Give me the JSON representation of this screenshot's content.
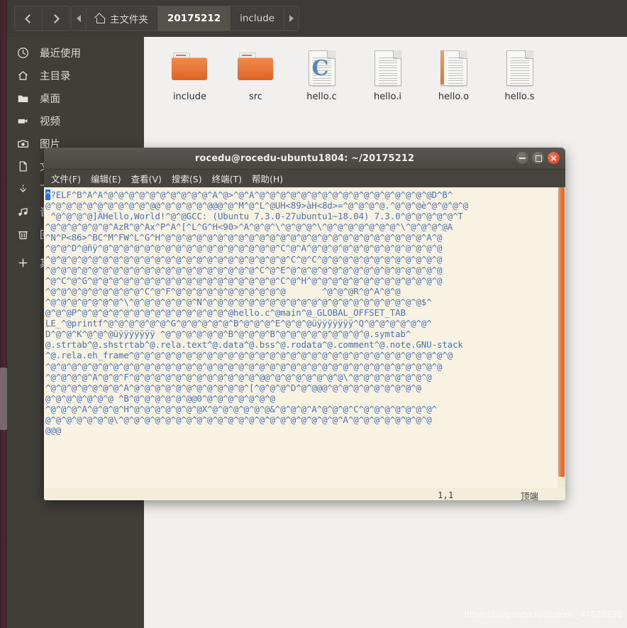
{
  "file_manager": {
    "nav": {
      "back_label": "‹",
      "forward_label": "›"
    },
    "breadcrumb": {
      "left_arrow": "◂",
      "right_arrow": "▸",
      "items": [
        {
          "label": "主文件夹",
          "icon": "home-icon",
          "active": false
        },
        {
          "label": "20175212",
          "icon": "",
          "active": true
        },
        {
          "label": "include",
          "icon": "",
          "active": false
        }
      ]
    },
    "sidebar": {
      "items": [
        {
          "label": "最近使用",
          "icon": "clock-icon"
        },
        {
          "label": "主目录",
          "icon": "home-icon"
        },
        {
          "label": "桌面",
          "icon": "folder-icon"
        },
        {
          "label": "视频",
          "icon": "video-icon"
        },
        {
          "label": "图片",
          "icon": "camera-icon"
        },
        {
          "label": "文档",
          "icon": "document-icon"
        },
        {
          "label": "下载",
          "icon": "download-icon"
        },
        {
          "label": "音乐",
          "icon": "music-icon"
        },
        {
          "label": "回收站",
          "icon": "trash-icon"
        },
        {
          "label": "其他位置",
          "icon": "plus-icon"
        }
      ]
    },
    "files": [
      {
        "name": "include",
        "type": "folder"
      },
      {
        "name": "src",
        "type": "folder"
      },
      {
        "name": "hello.c",
        "type": "c-source"
      },
      {
        "name": "hello.i",
        "type": "document"
      },
      {
        "name": "hello.o",
        "type": "object"
      },
      {
        "name": "hello.s",
        "type": "document"
      }
    ]
  },
  "terminal": {
    "title": "rocedu@rocedu-ubuntu1804: ~/20175212",
    "window_buttons": {
      "minimize": "minimize-button",
      "maximize": "maximize-button",
      "close": "close-button"
    },
    "menu": [
      "文件(F)",
      "编辑(E)",
      "查看(V)",
      "搜索(S)",
      "终端(T)",
      "帮助(H)"
    ],
    "status": {
      "position": "1,1",
      "location": "顶端"
    },
    "lines": [
      "^?ELF^B^A^A^@^@^@^@^@^@^@^@^@^@^A^@>^@^A^@^@^@^@^@^@^@^@^@^@^@^@^@^@^@^@^@D^B^",
      "@^@^@^@^@^@^@^@^@^@^@@^@^@^@^@^@@@^@^M^@^L^@UH<89>àH<8d>=^@^@^@^@.^@^@^@è^@^@^@^@",
      " ^@^@^@^@]ÄHello,World!^@^@GCC: (Ubuntu 7.3.0-27ubuntu1~18.04) 7.3.0^@^@^@^@^@^T",
      "^@^@^@^@^@^@^AzR^@^Ax^P^A^[^L^G^H<90>^A^@^@^\\^@^@^@^\\^@^@^@^@^@^@^@^\\^@^@^@^@A",
      "^N^P<86>^BC^M^FW^L^G^H^@^@^@^@^@^@^@^@^@^@^@^@^@^@^@^@^@^@^@^@^@^@^@^@^@^A^@",
      "^@^@^D^@ñÿ^@^@^@^@^@^@^@^@^@^@^@^@^@^@^@^@^@^C^@^A^@^@^@^@^@^@^@^@^@^@^@^@^@",
      "^@^@^@^@^@^@^@^@^@^@^@^@^@^@^@^@^@^@^@^@^@^@^@^C^@^C^@^@^@^@^@^@^@^@^@^@^@^@",
      "^@^@^@^@^@^@^@^@^@^@^@^@^@^@^@^@^@^@^@^@^C^@^E^@^@^@^@^@^@^@^@^@^@^@^@^@^@^@",
      "^@^C^@^G^@^@^@^@^@^@^@^@^@^@^@^@^@^@^@^@^@^@^C^@^H^@^@^@^@^@^@^@^@^@^@^@^@^@",
      "^@^@^@^@^@^@^@^@^@^C^@^F^@^@^@^@^@^@^@^@^@^@^@       ^@^@^@R^@^A^@^@",
      "^@^@^@^@^@^@^@^\\^@^@^@^@^@^@^N^@^@^@^@^@^@^@^@^@^@^@^@^@^@^@^@^@^@^@^@^@$^",
      "@^@^@P^@^@^@^@^@^@^@^@^@^@^@^@^@^@^@hello.c^@main^@_GLOBAL_OFFSET_TAB",
      "LE_^@printf^@^@^@^@^@^@^G^@^@^@^@^@^B^@^@^@^E^@^@^@üÿÿÿÿÿÿÿ^Q^@^@^@^@^@^@^",
      "D^@^@^K^@^@^@üÿÿÿÿÿÿÿ ^@^@^@^@^@^@^B^@^@^@^B^@^@^@^@^@^@^@^@^@.symtab^",
      "@.strtab^@.shstrtab^@.rela.text^@.data^@.bss^@.rodata^@.comment^@.note.GNU-stack",
      "^@.rela.eh_frame^@^@^@^@^@^@^@^@^@^@^@^@^@^@^@^@^@^@^@^@^@^@^@^@^@^@^@^@^@^@^@",
      "^@^@^@^@^@^@^@^@^@^@^@^@^@^@^@^@^@^@^@^@^@^@^@^@^@^@^@^@^@^@^@^@^@^@^@^@^@^@",
      "^@^@^@^@^A^@^@^F^@^@^@^@^@^@^@^@^@^@^@^@^@@^@^@^@^@^@^@^@\\^@^@^@^@^@^@^@^@",
      "^@^@^@^@^@^@^@^A^@^@^@^@^@^@^@^@^@^@^@^[^@^@^@^D^@^@@@^@^@^@^@^@^@^@^@^@",
      "@^@^@^@^@^@^@ ^B^@^@^@^@^@^@@0^@^@^@^@^@^@^@",
      "^@^@^@^A^@^@^@^H^@^@^@^@^@^@^@X^@^@^@^@^@^@&^@^@^@^A^@^@^@^C^@^@^@^@^@^@^@^",
      "@^@^@^@^@^@^@\\^@^@^@^@^@^@^@^@^@^@^@^@^@^@^@^@^@^@^@^@^@^A^@^@^@^@^@^@^@^@",
      "@@@"
    ]
  },
  "watermark": {
    "text": "https://blog.csdn.net/weixin_44826338"
  }
}
